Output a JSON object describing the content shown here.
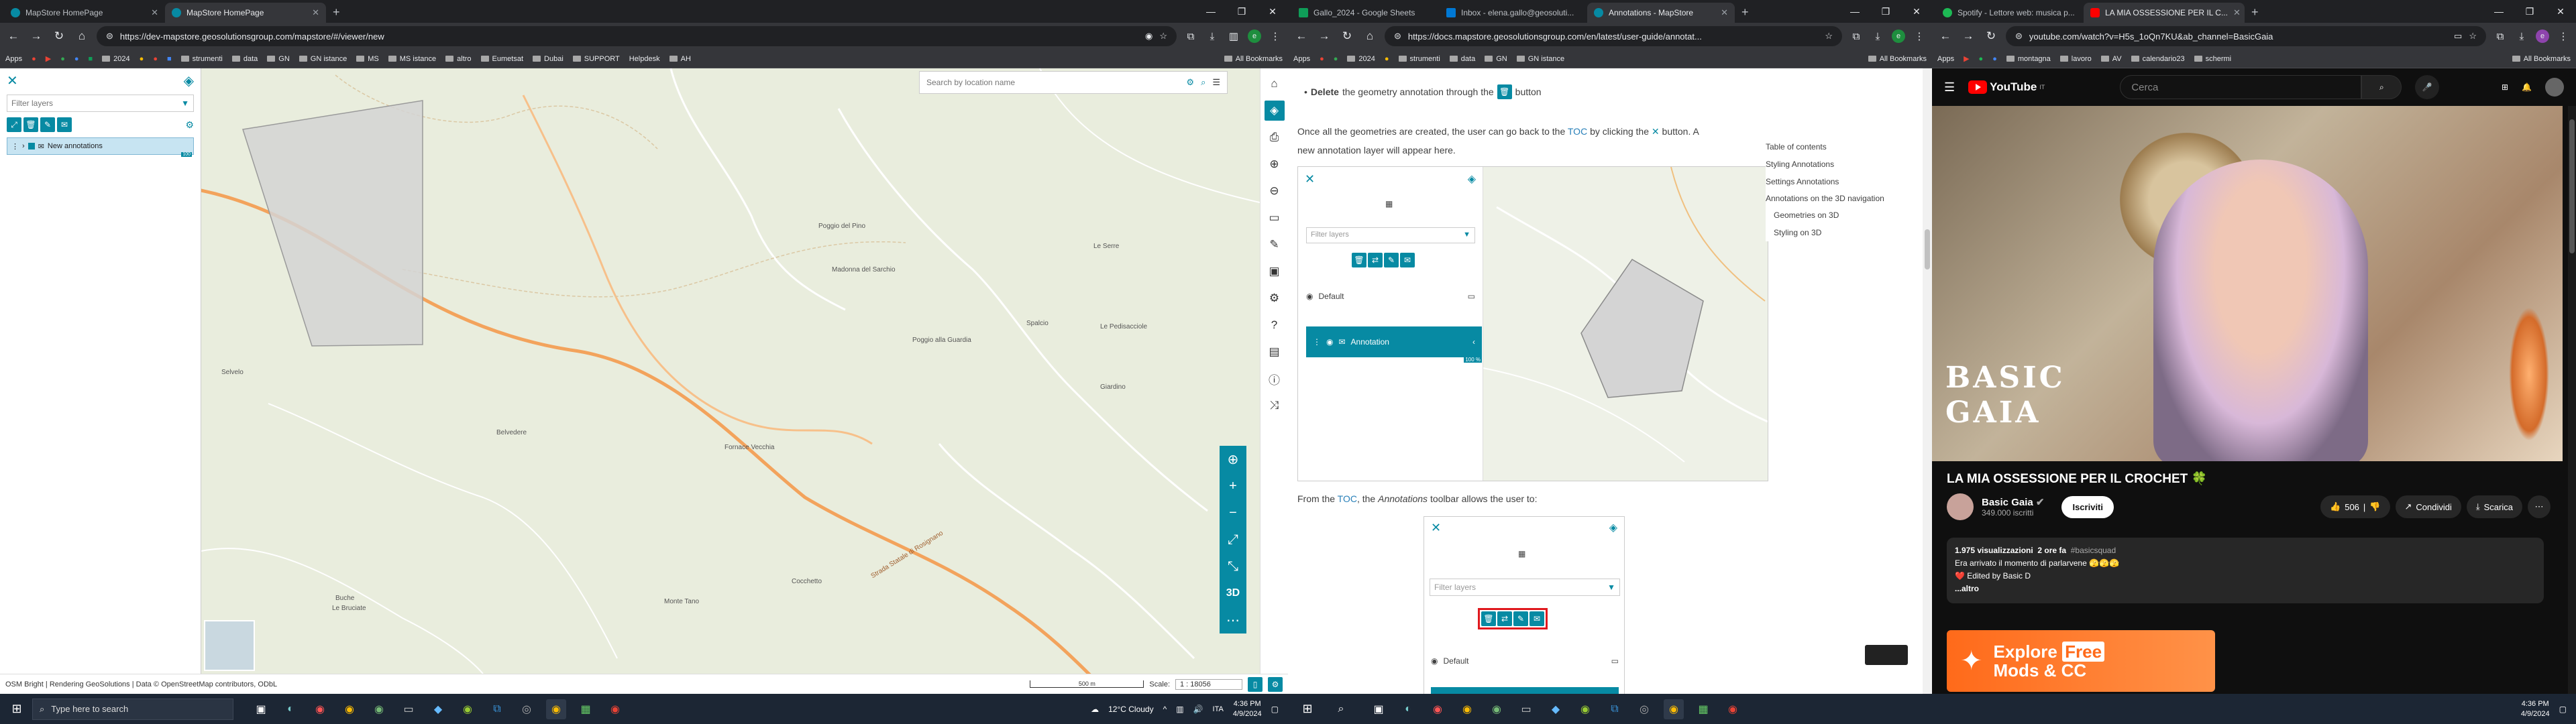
{
  "windows": {
    "left": {
      "tabs": [
        {
          "title": "MapStore HomePage",
          "active": false
        },
        {
          "title": "MapStore HomePage",
          "active": true
        }
      ],
      "url": "https://dev-mapstore.geosolutionsgroup.com/mapstore/#/viewer/new",
      "bookmarks": [
        "Apps",
        "2024",
        "strumenti",
        "data",
        "GN",
        "GN istance",
        "MS",
        "MS istance",
        "altro",
        "Eumetsat",
        "Dubai",
        "SUPPORT",
        "Helpdesk",
        "AH"
      ],
      "all_bookmarks": "All Bookmarks",
      "mapstore": {
        "filter_placeholder": "Filter layers",
        "layer_name": "New annotations",
        "search_placeholder": "Search by location name",
        "attribution": "OSM Bright | Rendering GeoSolutions | Data © OpenStreetMap contributors, ODbL",
        "scale_bar_label": "500 m",
        "scale_label": "Scale:",
        "scale_value": "1 : 18056",
        "view_3d": "3D",
        "place_labels": [
          {
            "text": "Belvedere"
          },
          {
            "text": "Poggio del Pino"
          },
          {
            "text": "Madonna del Sarchio"
          },
          {
            "text": "Le Serre"
          },
          {
            "text": "Spalcio"
          },
          {
            "text": "Le Pedisacciole"
          },
          {
            "text": "Poggio alla Guardia"
          },
          {
            "text": "Fornace Vecchia"
          },
          {
            "text": "Giardino"
          },
          {
            "text": "Cocchetto"
          },
          {
            "text": "Buche"
          },
          {
            "text": "Le Bruciate"
          },
          {
            "text": "Monte Tano"
          },
          {
            "text": "Selvelo"
          },
          {
            "text": "Strada Statale di Rosignano"
          }
        ]
      }
    },
    "middle": {
      "tabs": [
        {
          "title": "Gallo_2024 - Google Sheets",
          "active": false
        },
        {
          "title": "Inbox - elena.gallo@geosoluti...",
          "active": false
        },
        {
          "title": "Annotations - MapStore",
          "active": true
        }
      ],
      "url": "https://docs.mapstore.geosolutionsgroup.com/en/latest/user-guide/annotat...",
      "bookmarks": [
        "Apps",
        "2024",
        "strumenti",
        "data",
        "GN",
        "GN istance"
      ],
      "all_bookmarks": "All Bookmarks",
      "doc": {
        "bullet_delete": "Delete",
        "bullet_rest": " the geometry annotation through the",
        "bullet_end": "button",
        "para1_a": "Once all the geometries are created, the user can go back to the",
        "toc_link": "TOC",
        "para1_b": "by clicking the",
        "para1_c": "button. A new annotation layer will appear here.",
        "para2_a": "From the",
        "para2_b": ", the",
        "para2_c": "Annotations",
        "para2_d": "toolbar allows the user to:",
        "img1": {
          "filter": "Filter layers",
          "group": "Default",
          "layer": "Annotation",
          "percent": "100 %"
        },
        "img2": {
          "filter": "Filter layers",
          "group": "Default"
        },
        "page_toc": {
          "title": "Table of contents",
          "items": [
            "Styling Annotations",
            "Settings Annotations",
            "Annotations on the 3D navigation",
            "Geometries on 3D",
            "Styling on 3D"
          ]
        }
      }
    },
    "right": {
      "tabs": [
        {
          "title": "Spotify - Lettore web: musica p...",
          "active": false
        },
        {
          "title": "LA MIA OSSESSIONE PER IL C...",
          "active": true
        }
      ],
      "url": "youtube.com/watch?v=H5s_1oQn7KU&ab_channel=BasicGaia",
      "bookmarks": [
        "Apps",
        "montagna",
        "lavoro",
        "AV",
        "calendario23",
        "schermi"
      ],
      "all_bookmarks": "All Bookmarks",
      "youtube": {
        "logo": "YouTube",
        "logo_country": "IT",
        "search_placeholder": "Cerca",
        "video_title": "LA MIA OSSESSIONE PER IL CROCHET 🍀",
        "channel": "Basic Gaia",
        "subscribers": "349.000 iscritti",
        "subscribe": "Iscriviti",
        "likes": "506",
        "share": "Condividi",
        "download": "Scarica",
        "views": "1.975 visualizzazioni",
        "age": "2 ore fa",
        "hashtag": "#basicsquad",
        "desc1": "Era arrivato il momento di parlarvene 🫣🫣🫣",
        "desc2": "❤️ Edited by Basic D",
        "more": "...altro",
        "thumb_text": "BASIC GAIA",
        "ad_line1": "Explore",
        "ad_free": "Free",
        "ad_line2": "Mods & CC"
      }
    }
  },
  "taskbar_left": {
    "search_placeholder": "Type here to search",
    "weather": "12°C  Cloudy",
    "lang": "ITA",
    "time": "4:36 PM",
    "date": "4/9/2024"
  },
  "taskbar_right": {
    "time": "4:36 PM",
    "date": "4/9/2024"
  }
}
